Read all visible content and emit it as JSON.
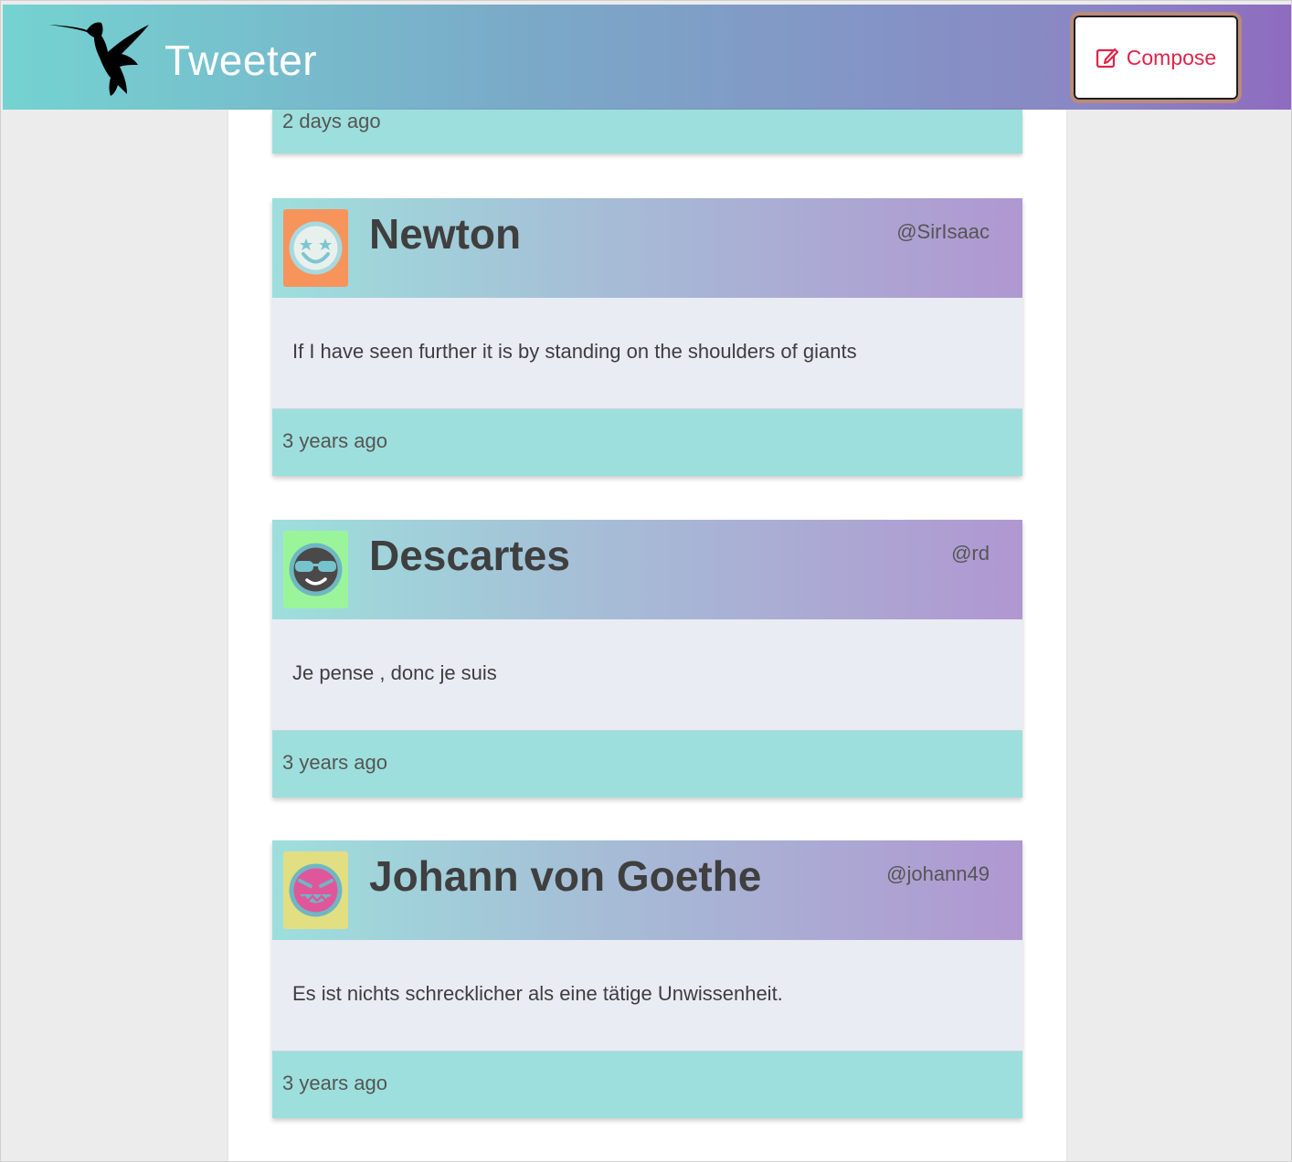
{
  "header": {
    "app_title": "Tweeter",
    "compose_label": "Compose",
    "logo_icon": "hummingbird-icon",
    "compose_icon": "edit-icon",
    "colors": {
      "gradient_start": "#74d3d1",
      "gradient_end": "#8e6bbf",
      "compose_text": "#e0244a"
    }
  },
  "feed": {
    "partial_tweet": {
      "timestamp": "2 days ago"
    },
    "tweets": [
      {
        "name": "Newton",
        "handle": "@SirIsaac",
        "text": "If I have seen further it is by standing on the shoulders of giants",
        "timestamp": "3 years ago",
        "avatar": "star-eyes-face-icon"
      },
      {
        "name": "Descartes",
        "handle": "@rd",
        "text": "Je pense , donc je suis",
        "timestamp": "3 years ago",
        "avatar": "sunglasses-face-icon"
      },
      {
        "name": "Johann von Goethe",
        "handle": "@johann49",
        "text": "Es ist nichts schrecklicher als eine tätige Unwissenheit.",
        "timestamp": "3 years ago",
        "avatar": "grinning-face-icon"
      }
    ]
  }
}
